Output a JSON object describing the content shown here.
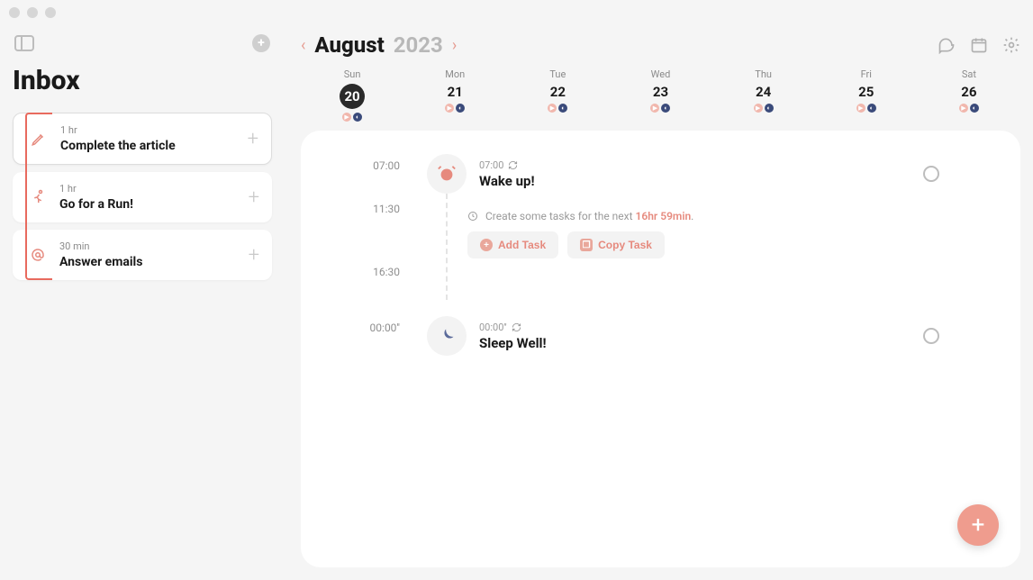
{
  "sidebar": {
    "title": "Inbox",
    "items": [
      {
        "duration": "1 hr",
        "title": "Complete the article",
        "icon": "pencil"
      },
      {
        "duration": "1 hr",
        "title": "Go for a Run!",
        "icon": "run"
      },
      {
        "duration": "30 min",
        "title": "Answer emails",
        "icon": "at"
      }
    ]
  },
  "header": {
    "month": "August",
    "year": "2023"
  },
  "week": [
    {
      "name": "Sun",
      "num": "20",
      "selected": true
    },
    {
      "name": "Mon",
      "num": "21",
      "selected": false
    },
    {
      "name": "Tue",
      "num": "22",
      "selected": false
    },
    {
      "name": "Wed",
      "num": "23",
      "selected": false
    },
    {
      "name": "Thu",
      "num": "24",
      "selected": false
    },
    {
      "name": "Fri",
      "num": "25",
      "selected": false
    },
    {
      "name": "Sat",
      "num": "26",
      "selected": false
    }
  ],
  "timeline": {
    "wake": {
      "slot": "07:00",
      "meta": "07:00",
      "title": "Wake up!"
    },
    "slots": [
      "11:30",
      "16:30"
    ],
    "gap": {
      "prefix": "Create some tasks for the next ",
      "highlight": "16hr 59min",
      "suffix": ".",
      "add": "Add Task",
      "copy": "Copy Task"
    },
    "sleep": {
      "slot": "00:00''",
      "meta": "00:00''",
      "title": "Sleep Well!"
    }
  }
}
